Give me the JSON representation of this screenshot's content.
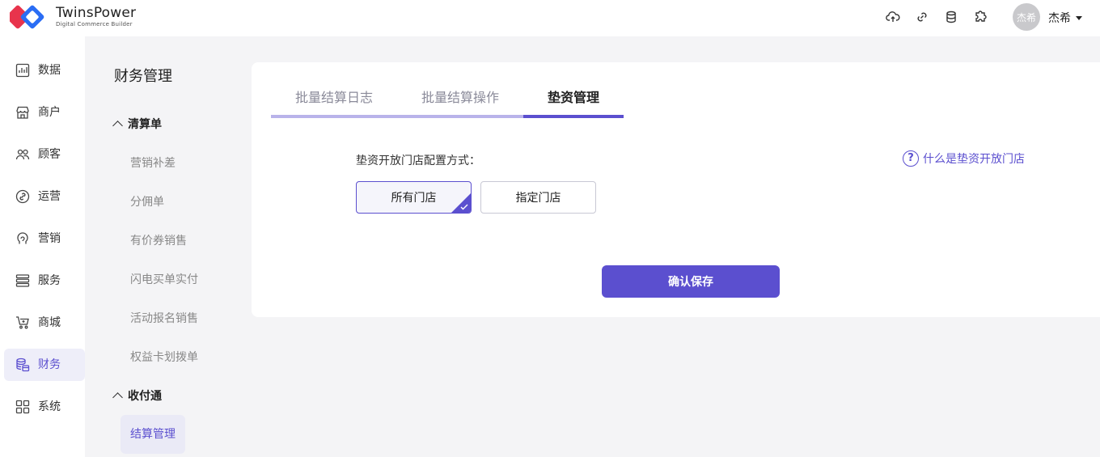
{
  "brand": {
    "name": "TwinsPower",
    "subtitle": "Digital Commerce Builder"
  },
  "header": {
    "icons": [
      "cloud-upload-icon",
      "link-icon",
      "database-icon",
      "puzzle-icon"
    ],
    "avatar_text": "杰希",
    "username": "杰希"
  },
  "leftnav": {
    "items": [
      {
        "label": "数据",
        "icon": "chart-icon"
      },
      {
        "label": "商户",
        "icon": "store-icon"
      },
      {
        "label": "顾客",
        "icon": "users-icon"
      },
      {
        "label": "运营",
        "icon": "operation-icon"
      },
      {
        "label": "营销",
        "icon": "marketing-icon"
      },
      {
        "label": "服务",
        "icon": "service-icon"
      },
      {
        "label": "商城",
        "icon": "cart-icon"
      },
      {
        "label": "财务",
        "icon": "finance-icon",
        "active": true
      },
      {
        "label": "系统",
        "icon": "grid-icon"
      }
    ]
  },
  "subnav": {
    "title": "财务管理",
    "groups": [
      {
        "label": "清算单",
        "items": [
          "营销补差",
          "分佣单",
          "有价券销售",
          "闪电买单实付",
          "活动报名销售",
          "权益卡划拨单"
        ]
      },
      {
        "label": "收付通",
        "items": [
          "结算管理"
        ]
      }
    ]
  },
  "tabs": [
    {
      "label": "批量结算日志"
    },
    {
      "label": "批量结算操作"
    },
    {
      "label": "垫资管理",
      "active": true
    }
  ],
  "form": {
    "config_label": "垫资开放门店配置方式：",
    "help_text": "什么是垫资开放门店",
    "options": [
      {
        "label": "所有门店",
        "selected": true
      },
      {
        "label": "指定门店",
        "selected": false
      }
    ],
    "save_label": "确认保存"
  },
  "colors": {
    "accent": "#5b4fcf",
    "tab_inactive_line": "#b9b3ea"
  }
}
